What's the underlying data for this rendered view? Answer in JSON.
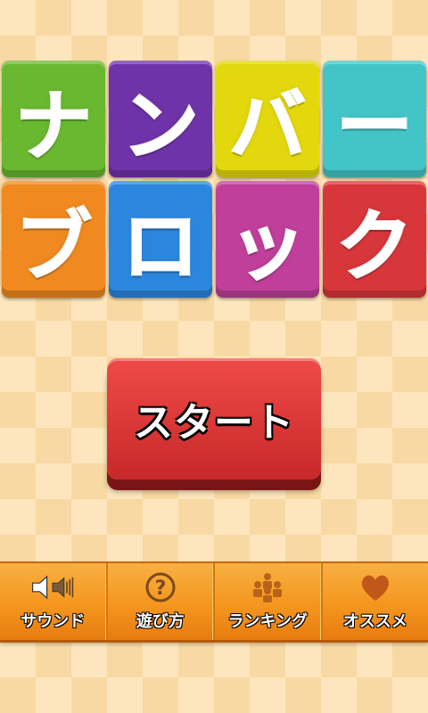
{
  "title": {
    "tiles": [
      {
        "char": "ナ",
        "color": "#6ab830"
      },
      {
        "char": "ン",
        "color": "#6f33a9"
      },
      {
        "char": "バ",
        "color": "#e3d80d"
      },
      {
        "char": "ー",
        "color": "#43c5c8"
      },
      {
        "char": "ブ",
        "color": "#f0891f"
      },
      {
        "char": "ロ",
        "color": "#2d86de"
      },
      {
        "char": "ッ",
        "color": "#bf3f9a"
      },
      {
        "char": "ク",
        "color": "#d7363a"
      }
    ]
  },
  "start": {
    "label": "スタート",
    "color": "#e03a3c"
  },
  "menu": {
    "items": [
      {
        "label": "サウンド",
        "icon": "speaker-icon"
      },
      {
        "label": "遊び方",
        "icon": "question-icon"
      },
      {
        "label": "ランキング",
        "icon": "ranking-people-icon"
      },
      {
        "label": "オススメ",
        "icon": "heart-icon"
      }
    ]
  }
}
